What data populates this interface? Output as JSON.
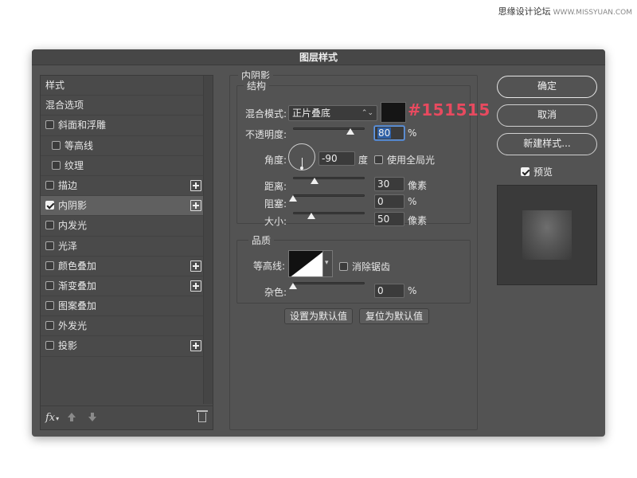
{
  "watermark": {
    "cn": "思缘设计论坛",
    "en": "WWW.MISSYUAN.COM"
  },
  "dialog": {
    "title": "图层样式"
  },
  "styles_list": {
    "items": [
      {
        "label": "样式",
        "checkbox": false,
        "checked": false,
        "plus": false,
        "indent": false,
        "selected": false
      },
      {
        "label": "混合选项",
        "checkbox": false,
        "checked": false,
        "plus": false,
        "indent": false,
        "selected": false
      },
      {
        "label": "斜面和浮雕",
        "checkbox": true,
        "checked": false,
        "plus": false,
        "indent": false,
        "selected": false
      },
      {
        "label": "等高线",
        "checkbox": true,
        "checked": false,
        "plus": false,
        "indent": true,
        "selected": false
      },
      {
        "label": "纹理",
        "checkbox": true,
        "checked": false,
        "plus": false,
        "indent": true,
        "selected": false
      },
      {
        "label": "描边",
        "checkbox": true,
        "checked": false,
        "plus": true,
        "indent": false,
        "selected": false
      },
      {
        "label": "内阴影",
        "checkbox": true,
        "checked": true,
        "plus": true,
        "indent": false,
        "selected": true
      },
      {
        "label": "内发光",
        "checkbox": true,
        "checked": false,
        "plus": false,
        "indent": false,
        "selected": false
      },
      {
        "label": "光泽",
        "checkbox": true,
        "checked": false,
        "plus": false,
        "indent": false,
        "selected": false
      },
      {
        "label": "颜色叠加",
        "checkbox": true,
        "checked": false,
        "plus": true,
        "indent": false,
        "selected": false
      },
      {
        "label": "渐变叠加",
        "checkbox": true,
        "checked": false,
        "plus": true,
        "indent": false,
        "selected": false
      },
      {
        "label": "图案叠加",
        "checkbox": true,
        "checked": false,
        "plus": false,
        "indent": false,
        "selected": false
      },
      {
        "label": "外发光",
        "checkbox": true,
        "checked": false,
        "plus": false,
        "indent": false,
        "selected": false
      },
      {
        "label": "投影",
        "checkbox": true,
        "checked": false,
        "plus": true,
        "indent": false,
        "selected": false
      }
    ],
    "footer": {
      "fx": "fx"
    }
  },
  "inner_shadow": {
    "section_title": "内阴影",
    "structure": {
      "title": "结构",
      "blend_mode_label": "混合模式:",
      "blend_mode_value": "正片叠底",
      "color_hex": "#151515",
      "color_annotation": "#151515",
      "opacity_label": "不透明度:",
      "opacity_value": "80",
      "opacity_unit": "%",
      "angle_label": "角度:",
      "angle_value": "-90",
      "angle_unit": "度",
      "global_light_label": "使用全局光",
      "global_light_checked": false,
      "distance_label": "距离:",
      "distance_value": "30",
      "distance_unit": "像素",
      "choke_label": "阻塞:",
      "choke_value": "0",
      "choke_unit": "%",
      "size_label": "大小:",
      "size_value": "50",
      "size_unit": "像素"
    },
    "quality": {
      "title": "品质",
      "contour_label": "等高线:",
      "antialias_label": "消除锯齿",
      "antialias_checked": false,
      "noise_label": "杂色:",
      "noise_value": "0",
      "noise_unit": "%"
    },
    "make_default_label": "设置为默认值",
    "reset_default_label": "复位为默认值"
  },
  "actions": {
    "ok_label": "确定",
    "cancel_label": "取消",
    "new_style_label": "新建样式...",
    "preview_label": "预览",
    "preview_checked": true
  }
}
